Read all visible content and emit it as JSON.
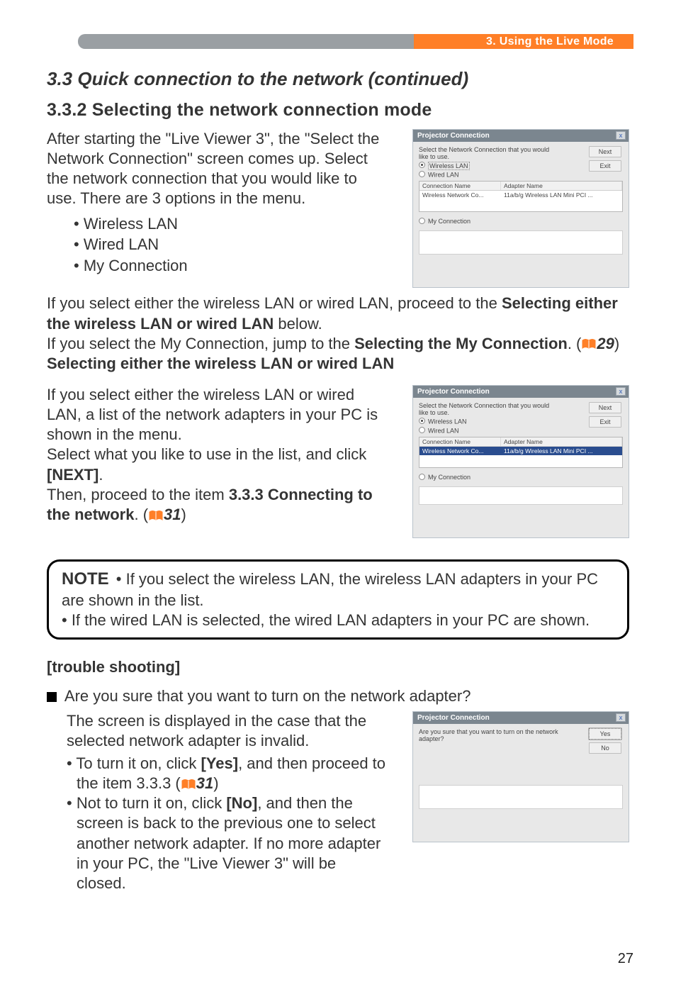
{
  "header": {
    "breadcrumb": "3. Using the Live Mode"
  },
  "section": {
    "title": "3.3 Quick connection to the network (continued)",
    "sub_title": "3.3.2 Selecting the network connection mode",
    "intro": "After starting the \"Live Viewer 3\", the \"Select the Network Connection\" screen comes up. Select the network connection that you would like to use. There are 3 options in the menu.",
    "options": [
      "• Wireless LAN",
      "• Wired LAN",
      "• My Connection"
    ],
    "para2_a": "If you select either the wireless LAN or wired LAN, proceed to the ",
    "para2_b": "Selecting either the wireless LAN or wired LAN",
    "para2_c": " below.",
    "para3_a": "If you select the My Connection, jump to the ",
    "para3_b": "Selecting the My Connection",
    "para3_c": ". (",
    "para3_ref": "29",
    "para3_d": ")",
    "sel_heading": "Selecting either the wireless LAN or wired LAN",
    "sel_p1": "If you select either the wireless LAN or wired LAN, a list of the network adapters in your PC is shown in the menu.",
    "sel_p2_a": "Select what you like to use in the list, and click ",
    "sel_p2_b": "[NEXT]",
    "sel_p2_c": ".",
    "sel_p3_a": "Then, proceed to the item ",
    "sel_p3_b": "3.3.3 Connecting to the network",
    "sel_p3_c": ". (",
    "sel_p3_ref": "31",
    "sel_p3_d": ")"
  },
  "note": {
    "label": "NOTE",
    "line1": " • If you select the wireless LAN, the wireless LAN adapters in your PC are shown in the list.",
    "line2": "• If the wired LAN is selected, the wired LAN adapters in your PC are shown."
  },
  "trouble": {
    "heading": "[trouble shooting]",
    "q": " Are you sure that you want to turn on the network adapter?",
    "p1": "The screen is displayed in the case that the selected network adapter is invalid.",
    "li1_a": "• To turn it on, click ",
    "li1_b": "[Yes]",
    "li1_c": ", and then proceed to the item 3.3.3 (",
    "li1_ref": "31",
    "li1_d": ")",
    "li2_a": "• Not to turn it on, click ",
    "li2_b": "[No]",
    "li2_c": ", and then the screen is back to the previous one to select another network adapter. If no more adapter in your PC, the \"Live Viewer 3\" will be closed."
  },
  "dialog_common": {
    "title": "Projector Connection",
    "select_text": "Select the Network Connection that you would like to use.",
    "wireless": "Wireless LAN",
    "wired": "Wired LAN",
    "myconn": "My Connection",
    "col_conn": "Connection Name",
    "col_adapter": "Adapter Name",
    "row_conn": "Wireless Network Co...",
    "row_adapter": "11a/b/g Wireless LAN Mini PCI ...",
    "next": "Next",
    "exit": "Exit",
    "close": "x"
  },
  "dialog3": {
    "prompt": "Are you sure that you want to turn on the network adapter?",
    "yes": "Yes",
    "no": "No"
  },
  "page_number": "27"
}
